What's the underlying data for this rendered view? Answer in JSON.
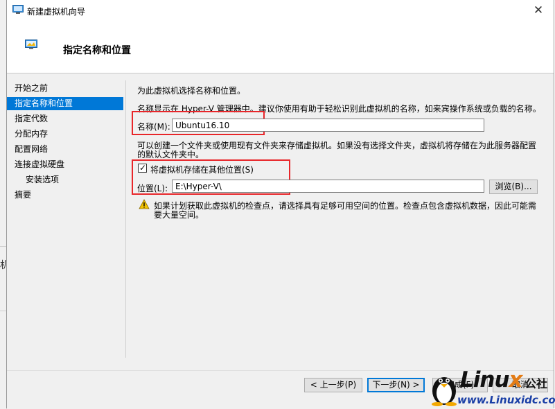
{
  "window": {
    "title": "新建虚拟机向导",
    "close_glyph": "✕"
  },
  "header": {
    "page_title": "指定名称和位置"
  },
  "nav": {
    "items": [
      {
        "label": "开始之前",
        "selected": false,
        "sub": false
      },
      {
        "label": "指定名称和位置",
        "selected": true,
        "sub": false
      },
      {
        "label": "指定代数",
        "selected": false,
        "sub": false
      },
      {
        "label": "分配内存",
        "selected": false,
        "sub": false
      },
      {
        "label": "配置网络",
        "selected": false,
        "sub": false
      },
      {
        "label": "连接虚拟硬盘",
        "selected": false,
        "sub": false
      },
      {
        "label": "安装选项",
        "selected": false,
        "sub": true
      },
      {
        "label": "摘要",
        "selected": false,
        "sub": false
      }
    ]
  },
  "content": {
    "intro": "为此虚拟机选择名称和位置。",
    "name_hint": "名称显示在 Hyper-V 管理器中。建议你使用有助于轻松识别此虚拟机的名称，如来宾操作系统或负载的名称。",
    "name_label": "名称(M):",
    "name_value": "Ubuntu16.10",
    "folder_hint_line1": "可以创建一个文件夹或使用现有文件夹来存储虚拟机。如果没有选择文件夹，虚拟机将存储在为此服务器配置",
    "folder_hint_line2": "的默认文件夹中。",
    "store_elsewhere_label": "将虚拟机存储在其他位置(S)",
    "store_elsewhere_checked": true,
    "location_label": "位置(L):",
    "location_value": "E:\\Hyper-V\\",
    "browse_label": "浏览(B)...",
    "warning_line1": "如果计划获取此虚拟机的检查点，请选择具有足够可用空间的位置。检查点包含虚拟机数据，因此可能需",
    "warning_line2": "要大量空间。"
  },
  "footer": {
    "prev_label": "< 上一步(P)",
    "next_label": "下一步(N) >",
    "finish_label": "完成(F)",
    "cancel_label": "取消"
  },
  "background_window": {
    "partial_char": "机"
  },
  "watermark": {
    "brand": "Linu",
    "brand_x": "x",
    "suffix": "公社",
    "url": "www.Linuxidc.com"
  },
  "colors": {
    "selection": "#0078d7",
    "highlight_box": "#e8262a",
    "warning": "#f2c200"
  }
}
